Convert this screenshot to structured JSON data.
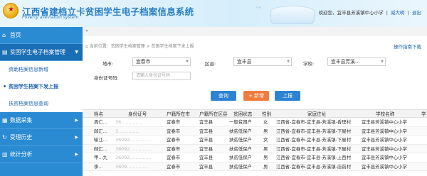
{
  "header": {
    "title": "江西省建档立卡贫困学生电子档案信息系统",
    "subtitle": "Poverty alleviation system",
    "welcome": "欢迎您，宜丰县芳溪镇中心小学",
    "user": "威大明",
    "logout": "退出"
  },
  "sidebar": {
    "home": "首页",
    "group_label": "贫困学生电子档案管理",
    "sub_items": [
      {
        "label": "资助档案信息新增"
      },
      {
        "label": "贫困学生档案下发上报"
      },
      {
        "label": "扶贫档案信息查询"
      }
    ],
    "data_collect": "数据采集",
    "history": "受理历史",
    "stats": "统计分析"
  },
  "main": {
    "toggle": "«",
    "breadcrumb": "当前位置：贫困学生档案管理  >  贫困学生档案下发上报",
    "guide": "操作指南下载",
    "form": {
      "city_label": "地市:",
      "city_value": "宜春市",
      "county_label": "区县:",
      "county_value": "宜丰县",
      "school_label": "学校:",
      "school_value": "宜丰县芳溪...",
      "id_label": "身份证号码:",
      "id_placeholder": "请输入身份证号码"
    },
    "buttons": {
      "query": "查询",
      "add": "+ 新增",
      "upload": "上报"
    }
  },
  "table": {
    "columns": [
      "姓名",
      "身份证号",
      "户籍所在市",
      "户籍所在区县",
      "贫困状态",
      "性别",
      "家庭住址",
      "学校名称",
      "学"
    ],
    "rows": [
      [
        "周仁...",
        "36...............",
        "宜春市",
        "宜丰县",
        "一般贫困户",
        "女",
        "江西省-宜春市-宜丰县-芳溪镇-香理村",
        "宜丰县芳溪镇中心小学",
        ""
      ],
      [
        "邮汇...",
        "3...............",
        "宜春市",
        "宜丰县",
        "扶贫低保户",
        "男",
        "江西省-宜春市-宜丰县-芳溪镇-下屋村",
        "宜丰县芳溪镇中心小学",
        ""
      ],
      [
        "喻江...",
        "36092...............",
        "宜春市",
        "宜丰县",
        "扶贫低保户",
        "女",
        "江西省-宜春市-宜丰县-芳溪镇-下屋村",
        "宜丰县芳溪镇中心小学",
        ""
      ],
      [
        "邮汇...",
        "36092...............",
        "宜春市",
        "宜丰县",
        "扶贫低保户",
        "男",
        "江西省-宜春市-宜丰县-芳溪镇-下屋村",
        "宜丰县芳溪镇中心小学",
        ""
      ],
      [
        "甲...九",
        "36092...............",
        "宜春市",
        "宜丰县",
        "扶贫低保户",
        "男",
        "江西省-宜春市-宜丰县-芳溪镇-上西村",
        "宜丰县芳溪镇中心小学",
        ""
      ],
      [
        "李...",
        "3609...............",
        "宜春市",
        "宜丰县",
        "扶贫低保户",
        "男",
        "江西省-宜春市-宜丰县-芳溪镇-店前村",
        "宜丰县芳溪镇中心小学",
        ""
      ]
    ]
  }
}
